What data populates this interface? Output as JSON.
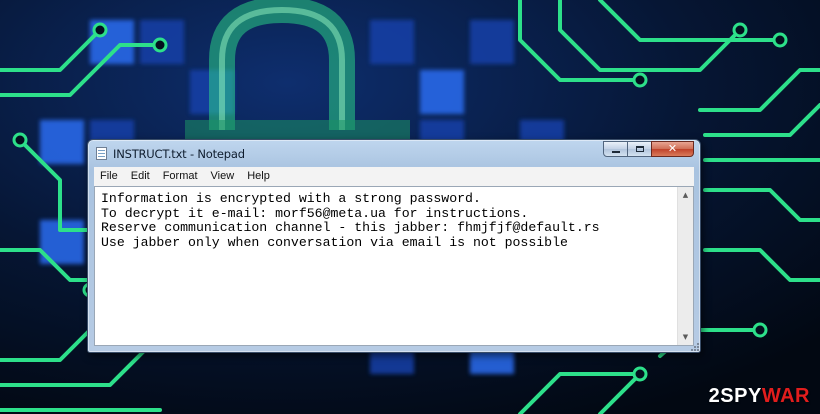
{
  "window": {
    "title": "INSTRUCT.txt - Notepad",
    "close_glyph": "✕"
  },
  "menu": [
    "File",
    "Edit",
    "Format",
    "View",
    "Help"
  ],
  "document": {
    "lines": [
      "Information is encrypted with a strong password.",
      "To decrypt it e-mail: morf56@meta.ua for instructions.",
      "Reserve communication channel - this jabber: fhmjfjf@default.rs",
      "Use jabber only when conversation via email is not possible"
    ]
  },
  "watermark": {
    "prefix": "2",
    "spy": "SPY",
    "war": "WAR"
  },
  "icons": {
    "app": "notepad-icon",
    "minimize": "minimize-icon",
    "maximize": "maximize-icon",
    "close": "close-icon",
    "background": "padlock-circuit-board"
  },
  "colors": {
    "circuit": "#2de08a",
    "tiles": "#1b4fd6",
    "close_button": "#c7472f",
    "watermark_accent": "#e11d1d"
  }
}
